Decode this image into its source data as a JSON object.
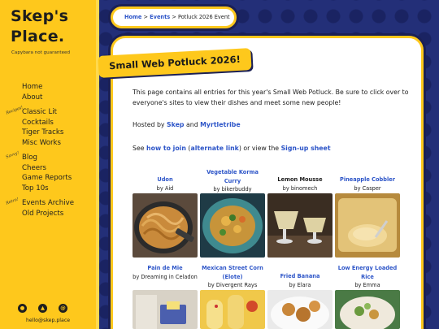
{
  "sidebar": {
    "title_line1": "Skep's",
    "title_line2": "Place.",
    "tagline": "Capybara not guaranteed",
    "groups": [
      {
        "tag": "",
        "items": [
          "Home",
          "About"
        ]
      },
      {
        "tag": "Recipes!",
        "items": [
          "Classic Lit",
          "Cocktails",
          "Tiger Tracks",
          "Misc Works"
        ]
      },
      {
        "tag": "Savvy!",
        "items": [
          "Blog",
          "Cheers",
          "Game Reports",
          "Top 10s"
        ]
      },
      {
        "tag": "Retro!",
        "items": [
          "Events Archive",
          "Old Projects"
        ]
      }
    ],
    "social_icons": [
      "lightbulb-icon",
      "triangle-icon",
      "at-sign-icon"
    ],
    "email": "hello@skep.place"
  },
  "breadcrumb": {
    "home": "Home",
    "sep1": ">",
    "events": "Events",
    "sep2": ">",
    "current": "Potluck 2026 Event"
  },
  "page": {
    "title": "Small Web Potluck 2026!",
    "intro": "This page contains all entries for this year's Small Web Potluck. Be sure to click over to everyone's sites to view their dishes and meet some new people!",
    "hosted_prefix": "Hosted by ",
    "host1": "Skep",
    "hosted_and": " and ",
    "host2": "Myrtletribe",
    "see_prefix": "See ",
    "how_to_join": "how to join",
    "paren_open": " (",
    "alternate_link": "alternate link",
    "paren_close": ") or view the ",
    "signup": "Sign-up sheet"
  },
  "entries": [
    {
      "name": "Udon",
      "by": "by Aid",
      "linked": true
    },
    {
      "name": "Vegetable Korma Curry",
      "by": "by bikerbuddy",
      "linked": true
    },
    {
      "name": "Lemon Mousse",
      "by": "by binomech",
      "linked": false
    },
    {
      "name": "Pineapple Cobbler",
      "by": "by Casper",
      "linked": true
    },
    {
      "name": "Pain de Mie",
      "by": "by Dreaming in Celadon",
      "linked": true
    },
    {
      "name": "Mexican Street Corn (Elote)",
      "by": "by Divergent Rays",
      "linked": true
    },
    {
      "name": "Fried Banana",
      "by": "by Elara",
      "linked": true
    },
    {
      "name": "Low Energy Loaded Rice",
      "by": "by Emma",
      "linked": true
    }
  ]
}
